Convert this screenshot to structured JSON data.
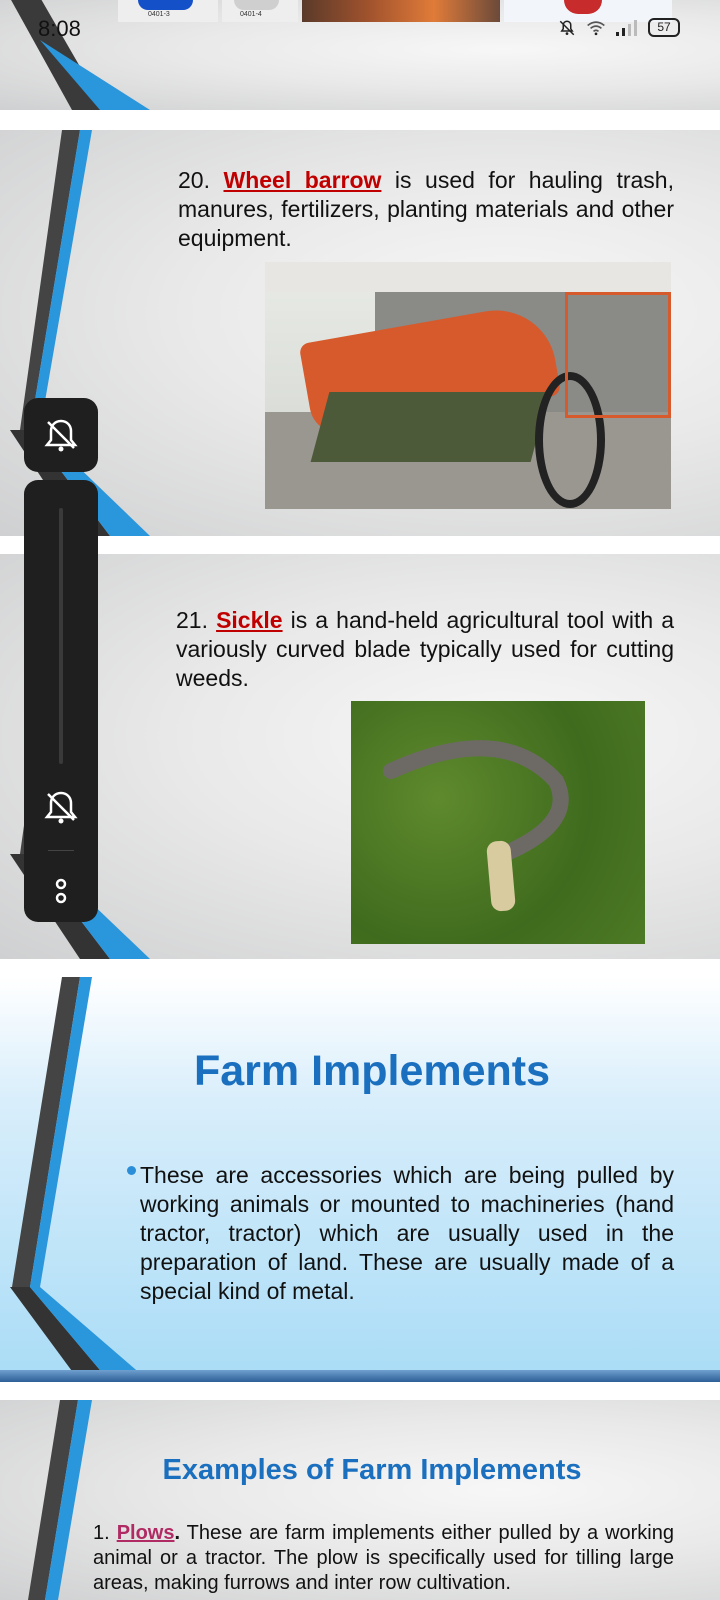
{
  "status_bar": {
    "time": "8:08",
    "battery": "57"
  },
  "top_strip": {
    "thumb1_label": "0401-3",
    "thumb2_label": "0401-4"
  },
  "slide20": {
    "number": "20.",
    "keyword": "Wheel barrow",
    "rest": " is used for hauling trash, manures, fertilizers, planting materials and other equipment."
  },
  "slide21": {
    "number": "21.",
    "keyword": "Sickle",
    "rest": " is a hand-held agricultural tool with a variously curved blade typically used for cutting weeds."
  },
  "slide_farm": {
    "title": "Farm Implements",
    "bullet": "These are accessories which are being pulled by working animals or mounted to machineries (hand tractor, tractor) which are usually used in the preparation of land. These are usually made of a special kind of metal."
  },
  "slide_examples": {
    "title": "Examples of Farm Implements",
    "number": "1.",
    "keyword": "Plows",
    "period": ".",
    "rest": " These are farm implements either pulled by a working animal or a tractor. The plow is specifically used for tilling large areas, making furrows and inter row cultivation."
  },
  "icons": {
    "mute_bell": "bell-off-icon",
    "more": "more-options-icon",
    "wifi": "wifi-icon",
    "signal": "signal-icon"
  },
  "colors": {
    "accent_blue": "#1a6fbf",
    "keyword_red": "#c00000",
    "keyword_pink": "#b02a63"
  }
}
